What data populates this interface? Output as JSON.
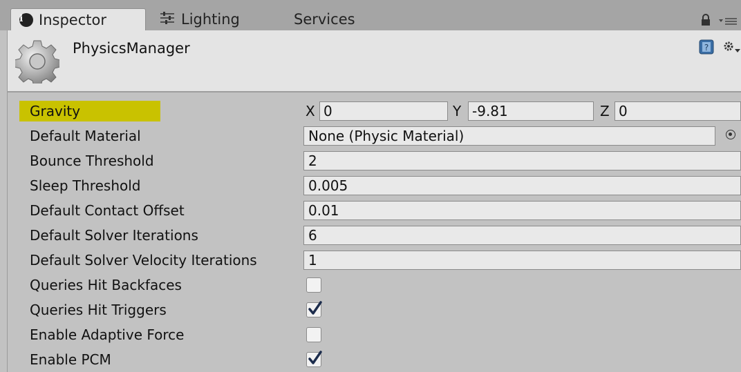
{
  "tabs": [
    {
      "label": "Inspector",
      "icon": "info-icon",
      "active": true
    },
    {
      "label": "Lighting",
      "icon": "lighting-icon",
      "active": false
    },
    {
      "label": "Services",
      "icon": "",
      "active": false
    }
  ],
  "header": {
    "title": "PhysicsManager",
    "icon": "gear-icon"
  },
  "gravity": {
    "label": "Gravity",
    "x_label": "X",
    "x": "0",
    "y_label": "Y",
    "y": "-9.81",
    "z_label": "Z",
    "z": "0"
  },
  "properties": [
    {
      "label": "Default Material",
      "value": "None (Physic Material)"
    },
    {
      "label": "Bounce Threshold",
      "value": "2"
    },
    {
      "label": "Sleep Threshold",
      "value": "0.005"
    },
    {
      "label": "Default Contact Offset",
      "value": "0.01"
    },
    {
      "label": "Default Solver Iterations",
      "value": "6"
    },
    {
      "label": "Default Solver Velocity Iterations",
      "value": "1"
    }
  ],
  "toggles": [
    {
      "label": "Queries Hit Backfaces",
      "checked": false
    },
    {
      "label": "Queries Hit Triggers",
      "checked": true
    },
    {
      "label": "Enable Adaptive Force",
      "checked": false
    },
    {
      "label": "Enable PCM",
      "checked": true
    }
  ],
  "colors": {
    "highlight": "#c9c200",
    "panel": "#c2c2c2",
    "header": "#e4e4e4"
  }
}
